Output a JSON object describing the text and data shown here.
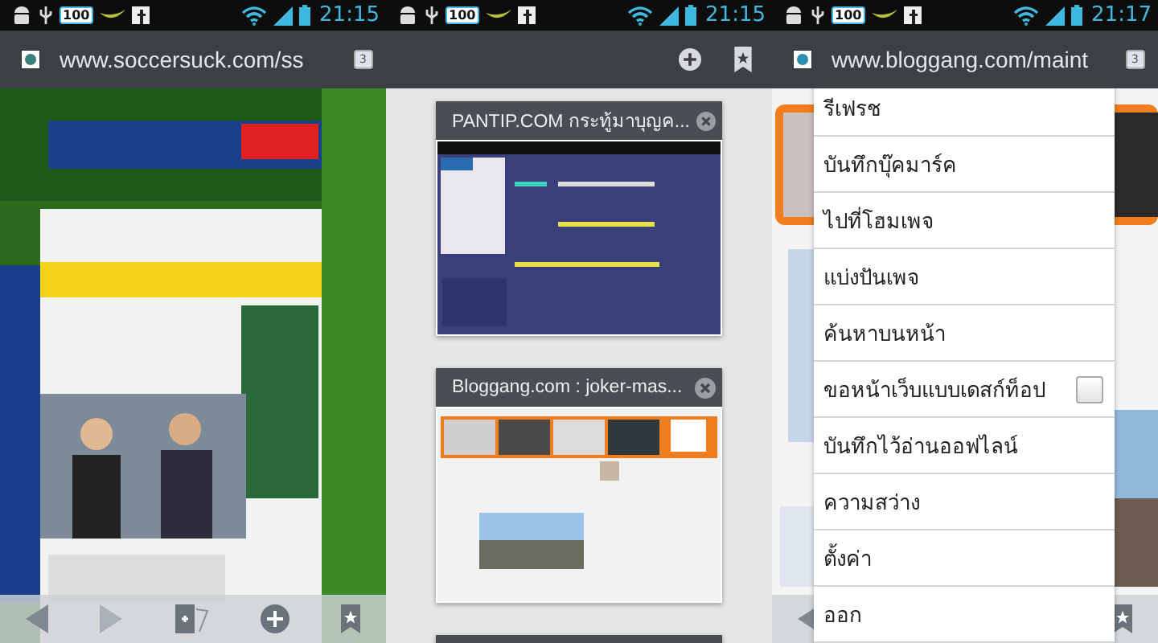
{
  "panels": [
    {
      "kind": "page",
      "status": {
        "battery_badge": "100",
        "time": "21:15"
      },
      "address": "www.soccersuck.com/ss",
      "tab_count": "3",
      "toolbar": true
    },
    {
      "kind": "tabs",
      "status": {
        "battery_badge": "100",
        "time": "21:15"
      },
      "tabs": [
        {
          "title": "PANTIP.COM กระทู้มาบุญค...",
          "kind": "dark"
        },
        {
          "title": "Bloggang.com : joker-mas...",
          "kind": "light"
        }
      ],
      "more_below": true
    },
    {
      "kind": "menu",
      "status": {
        "battery_badge": "100",
        "time": "21:17"
      },
      "address": "www.bloggang.com/maint",
      "tab_count": "3",
      "toolbar": true,
      "menu": [
        {
          "label": "รีเฟรช",
          "kind": "plain"
        },
        {
          "label": "บันทึกบุ๊คมาร์ค",
          "kind": "plain"
        },
        {
          "label": "ไปที่โฮมเพจ",
          "kind": "plain"
        },
        {
          "label": "แบ่งปันเพจ",
          "kind": "plain"
        },
        {
          "label": "ค้นหาบนหน้า",
          "kind": "plain"
        },
        {
          "label": "ขอหน้าเว็บแบบเดสก์ท็อป",
          "kind": "checkbox",
          "checked": false
        },
        {
          "label": "บันทึกไว้อ่านออฟไลน์",
          "kind": "plain"
        },
        {
          "label": "ความสว่าง",
          "kind": "plain"
        },
        {
          "label": "ตั้งค่า",
          "kind": "plain"
        },
        {
          "label": "ออก",
          "kind": "plain"
        }
      ]
    }
  ]
}
